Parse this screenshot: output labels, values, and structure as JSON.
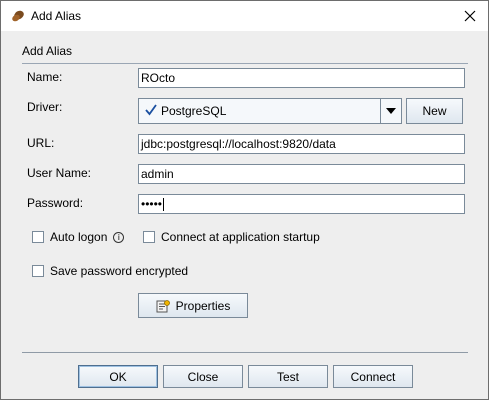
{
  "window": {
    "title": "Add Alias",
    "app_icon": "coffee-bean-icon",
    "close_icon": "close-icon"
  },
  "group": {
    "title": "Add Alias"
  },
  "form": {
    "name_label": "Name:",
    "name_value": "ROcto",
    "driver_label": "Driver:",
    "driver_value": "PostgreSQL",
    "driver_status_icon": "checkmark-icon",
    "new_label": "New",
    "url_label": "URL:",
    "url_value": "jdbc:postgresql://localhost:9820/data",
    "user_label": "User Name:",
    "user_value": "admin",
    "password_label": "Password:",
    "password_mask": "•••••",
    "auto_logon_label": "Auto logon",
    "auto_logon_checked": false,
    "connect_startup_label": "Connect at application startup",
    "connect_startup_checked": false,
    "save_password_label": "Save password encrypted",
    "save_password_checked": false,
    "properties_label": "Properties"
  },
  "buttons": {
    "ok": "OK",
    "close": "Close",
    "test": "Test",
    "connect": "Connect"
  },
  "colors": {
    "accent": "#1a4fa0",
    "border": "#7a8a99",
    "panel": "#eeeeee"
  }
}
